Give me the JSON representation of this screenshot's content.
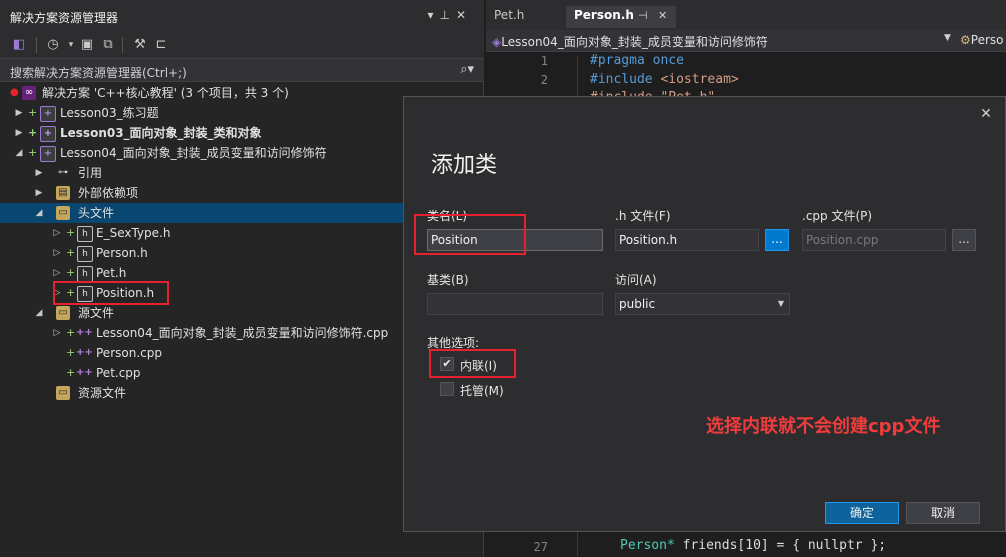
{
  "solution_explorer": {
    "title": "解决方案资源管理器",
    "title_buttons": [
      "▾",
      "⊥",
      "✕"
    ],
    "search_placeholder": "搜索解决方案资源管理器(Ctrl+;)",
    "tree": {
      "solution": "解决方案 'C++核心教程' (3 个项目，共 3 个)",
      "project1": "Lesson03_练习题",
      "project2": "Lesson03_面向对象_封装_类和对象",
      "project3": "Lesson04_面向对象_封装_成员变量和访问修饰符",
      "references": "引用",
      "external_deps": "外部依赖项",
      "header_files": "头文件",
      "h1": "E_SexType.h",
      "h2": "Person.h",
      "h3": "Pet.h",
      "h4": "Position.h",
      "source_files": "源文件",
      "cpp1": "Lesson04_面向对象_封装_成员变量和访问修饰符.cpp",
      "cpp2": "Person.cpp",
      "cpp3": "Pet.cpp",
      "resource_files": "资源文件"
    }
  },
  "editor": {
    "tabs": [
      {
        "label": "Pet.h"
      },
      {
        "label": "Person.h"
      }
    ],
    "tab_pin": "⊣",
    "tab_close": "✕",
    "nav_left": "Lesson04_面向对象_封装_成员变量和访问修饰符",
    "nav_right": "Perso",
    "lines": [
      {
        "num": "1",
        "keyword": "#pragma",
        "rest": " once"
      },
      {
        "num": "2",
        "keyword": "#include",
        "rest": " <iostream>"
      },
      {
        "num": "27",
        "keyword": "Person*",
        "rest": " friends[10] = { nullptr };"
      }
    ]
  },
  "dialog": {
    "title": "添加类",
    "close": "✕",
    "class_name_label": "类名(L)",
    "class_name_value": "Position",
    "h_file_label": ".h 文件(F)",
    "h_file_value": "Position.h",
    "cpp_file_label": ".cpp 文件(P)",
    "cpp_file_value": "Position.cpp",
    "browse": "...",
    "base_class_label": "基类(B)",
    "base_class_value": "",
    "access_label": "访问(A)",
    "access_value": "public",
    "other_options_label": "其他选项:",
    "inline_label": "内联(I)",
    "inline_checked": true,
    "managed_label": "托管(M)",
    "managed_checked": false,
    "ok": "确定",
    "cancel": "取消"
  },
  "annotation": "选择内联就不会创建cpp文件",
  "colors": {
    "accent": "#007acc",
    "selection": "#094771",
    "highlight_box": "#e8212e",
    "annotation": "#f03c3c"
  }
}
